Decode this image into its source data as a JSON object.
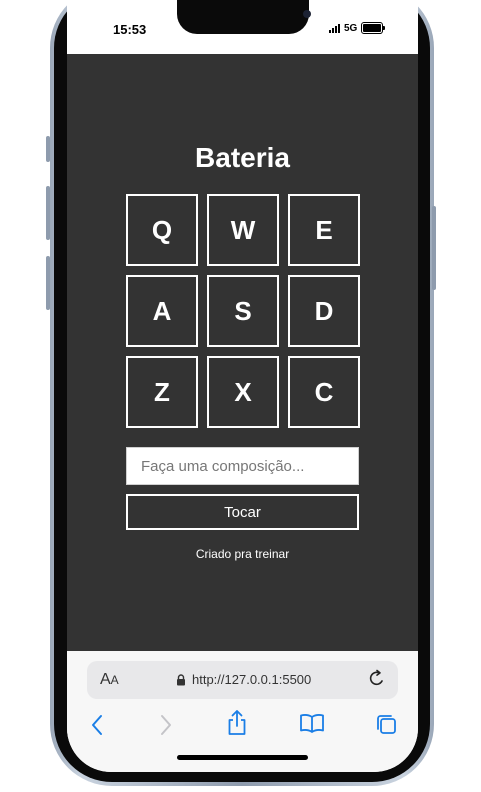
{
  "status_bar": {
    "time": "15:53",
    "network": "5G"
  },
  "app": {
    "title": "Bateria",
    "pads": [
      "Q",
      "W",
      "E",
      "A",
      "S",
      "D",
      "Z",
      "X",
      "C"
    ],
    "composer_placeholder": "Faça uma composição...",
    "composer_value": "",
    "play_label": "Tocar",
    "credit": "Criado pra treinar"
  },
  "browser": {
    "text_size_label_big": "A",
    "text_size_label_small": "A",
    "url": "http://127.0.0.1:5500",
    "toolbar_icons": [
      "back-icon",
      "forward-icon",
      "share-icon",
      "bookmarks-icon",
      "tabs-icon"
    ]
  },
  "colors": {
    "page_bg": "#333333",
    "accent": "#1a7ee6",
    "text": "#ffffff"
  }
}
